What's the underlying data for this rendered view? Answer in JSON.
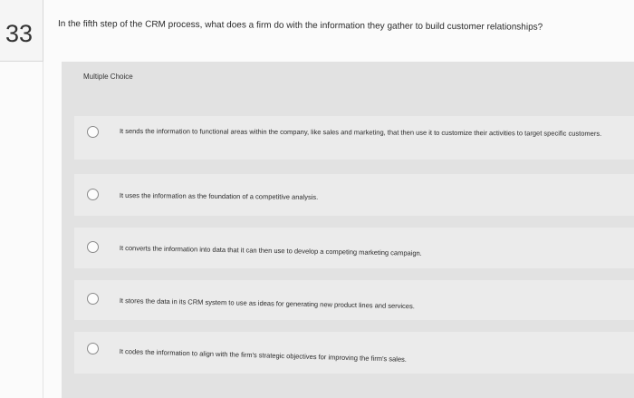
{
  "question_number": "33",
  "question_text": "In the fifth step of the CRM process, what does a firm do with the information they gather to build customer relationships?",
  "question_type": "Multiple Choice",
  "options": [
    {
      "text": "It sends the information to functional areas within the company, like sales and marketing, that then use it to customize their activities to target specific customers."
    },
    {
      "text": "It uses the information as the foundation of a competitive analysis."
    },
    {
      "text": "It converts the information into data that it can then use to develop a competing marketing campaign."
    },
    {
      "text": "It stores the data in its CRM system to use as ideas for generating new product lines and services."
    },
    {
      "text": "It codes the information to align with the firm's strategic objectives for improving the firm's sales."
    }
  ]
}
